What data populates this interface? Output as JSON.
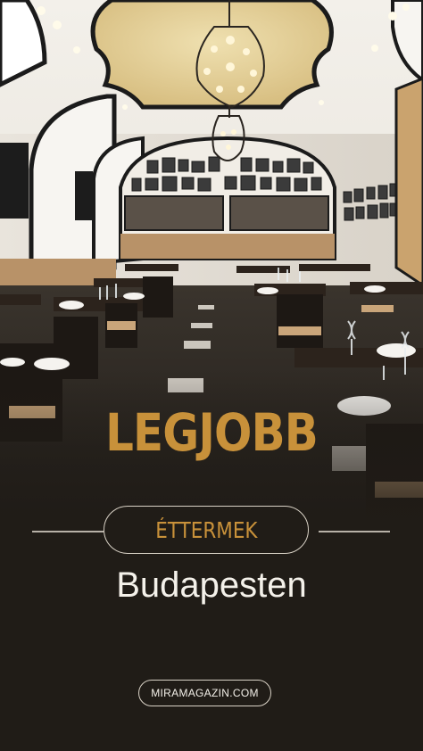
{
  "headline": "LEGJOBB",
  "subheading": "ÉTTERMEK",
  "city": "Budapesten",
  "website": "MIRAMAGAZIN.COM",
  "colors": {
    "background": "#201c17",
    "accent_gold": "#c8913a",
    "text_light": "#f4f1ea",
    "outline": "#d9d2c6"
  }
}
